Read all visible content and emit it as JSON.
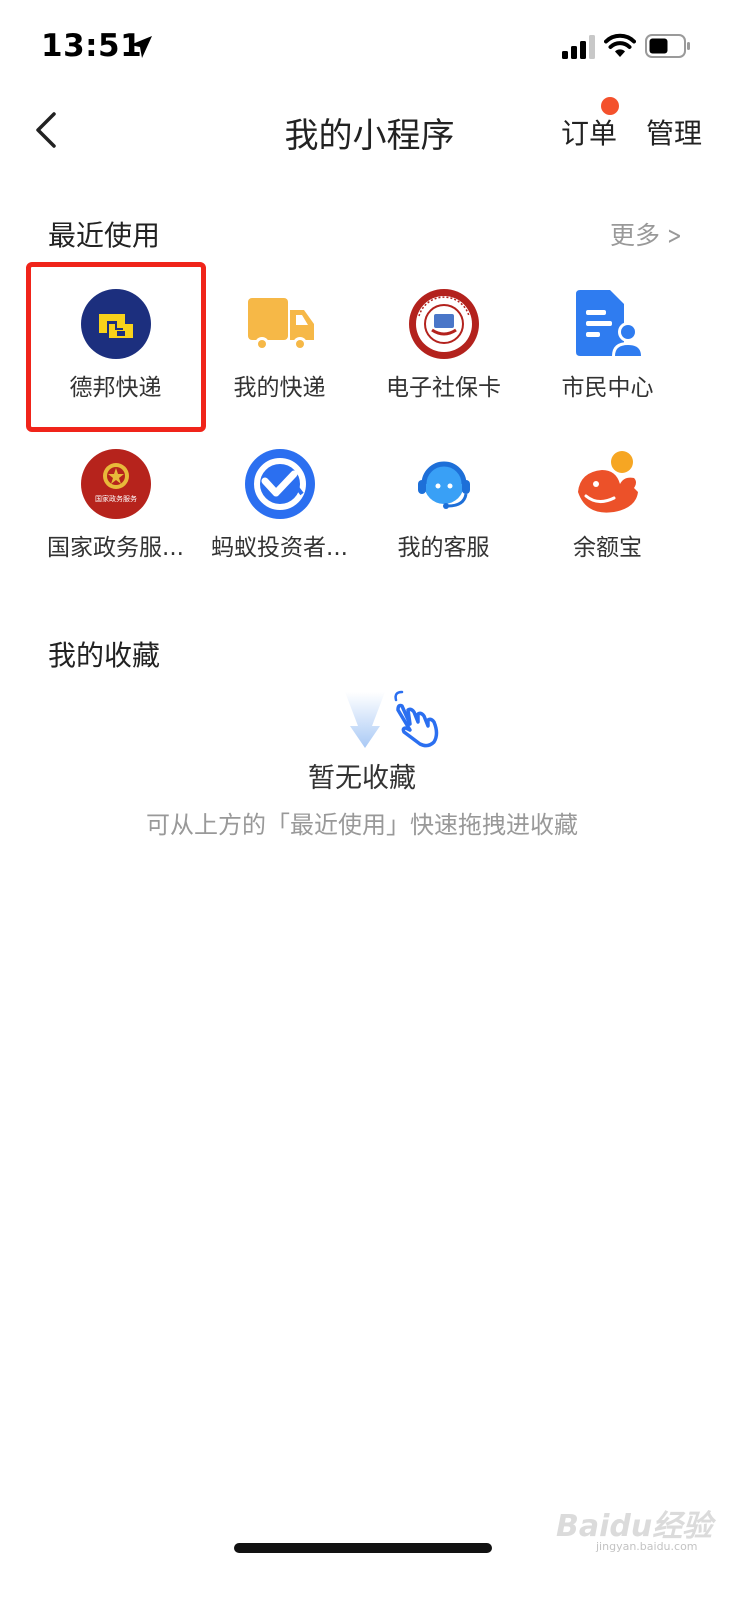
{
  "status": {
    "time": "13:51"
  },
  "nav": {
    "title": "我的小程序",
    "orders_label": "订单",
    "manage_label": "管理"
  },
  "recent": {
    "title": "最近使用",
    "more_label": "更多",
    "apps": [
      {
        "label": "德邦快递",
        "icon": "deppon-logo-icon"
      },
      {
        "label": "我的快递",
        "icon": "delivery-truck-icon"
      },
      {
        "label": "电子社保卡",
        "icon": "social-security-card-icon",
        "icon_text": "SOCIAL SECURITY CARD"
      },
      {
        "label": "市民中心",
        "icon": "citizen-center-icon"
      },
      {
        "label": "国家政务服...",
        "icon": "national-emblem-icon",
        "icon_text": "国家政务服务"
      },
      {
        "label": "蚂蚁投资者...",
        "icon": "ant-investor-icon"
      },
      {
        "label": "我的客服",
        "icon": "customer-service-icon"
      },
      {
        "label": "余额宝",
        "icon": "yuebao-icon"
      }
    ]
  },
  "favorites": {
    "title": "我的收藏",
    "empty_title": "暂无收藏",
    "empty_hint": "可从上方的「最近使用」快速拖拽进收藏"
  },
  "watermark": {
    "text": "Baidu经验",
    "sub": "jingyan.baidu.com"
  },
  "colors": {
    "highlight": "#f0241a",
    "badge": "#f4512c",
    "accent_blue": "#2b6ff0"
  }
}
